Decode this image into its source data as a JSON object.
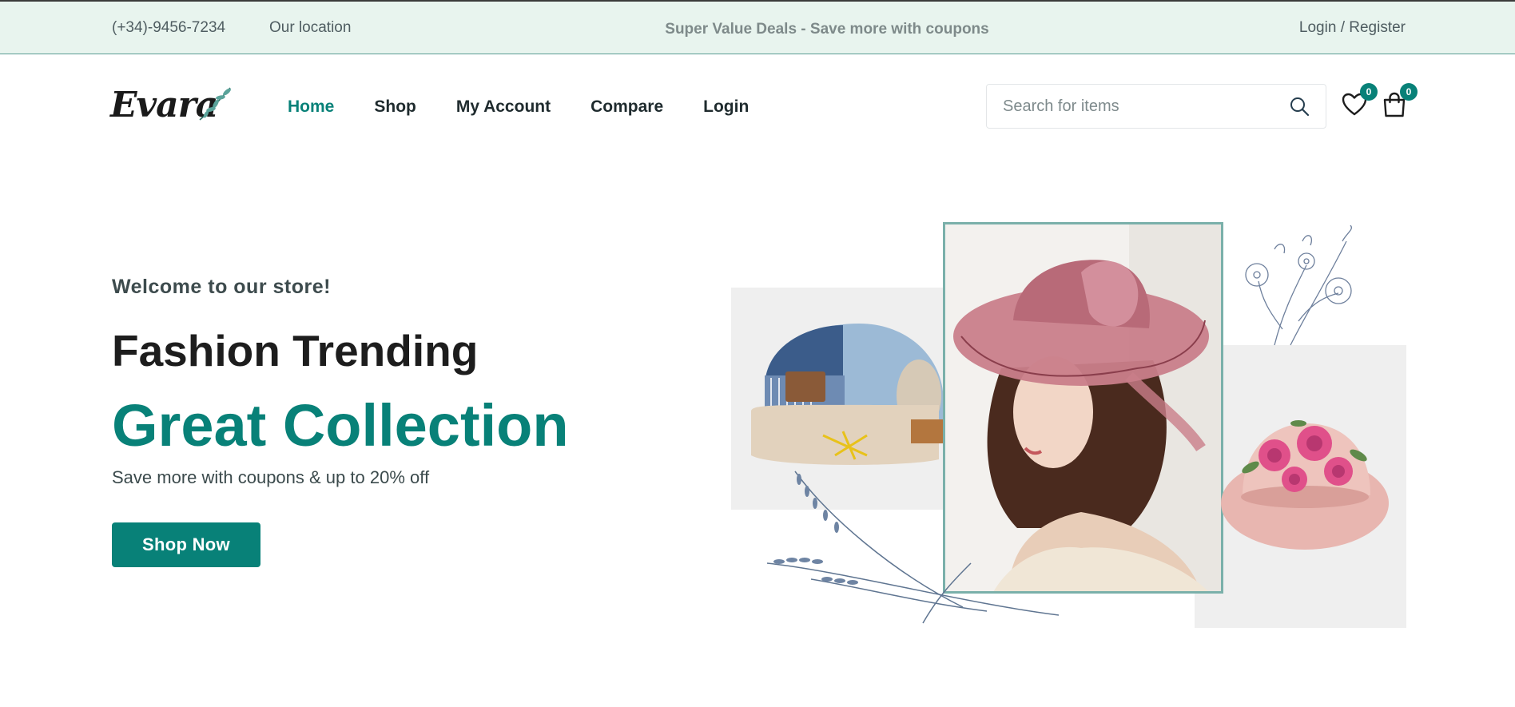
{
  "topbar": {
    "phone": "(+34)-9456-7234",
    "location": "Our location",
    "deal": "Super Value Deals - Save more with coupons",
    "auth": "Login / Register"
  },
  "header": {
    "logo_text": "Evara",
    "nav": [
      {
        "label": "Home",
        "active": true
      },
      {
        "label": "Shop"
      },
      {
        "label": "My Account"
      },
      {
        "label": "Compare"
      },
      {
        "label": "Login"
      }
    ],
    "search": {
      "placeholder": "Search for items",
      "value": ""
    },
    "wishlist_count": "0",
    "cart_count": "0",
    "icons": [
      "search-icon",
      "heart-icon",
      "shopping-bag-icon"
    ]
  },
  "hero": {
    "welcome": "Welcome to our store!",
    "title": "Fashion Trending",
    "highlight": "Great Collection",
    "subtitle": "Save more with coupons & up to 20% off",
    "cta": "Shop Now",
    "images": [
      "denim-cap-image",
      "woman-in-pink-hat-image",
      "pink-floral-hat-image",
      "lavender-sketch",
      "flower-sketch"
    ]
  },
  "colors": {
    "brand": "#088178",
    "topbar_bg": "#e8f4ee",
    "text_dark": "#1d1d1d"
  }
}
